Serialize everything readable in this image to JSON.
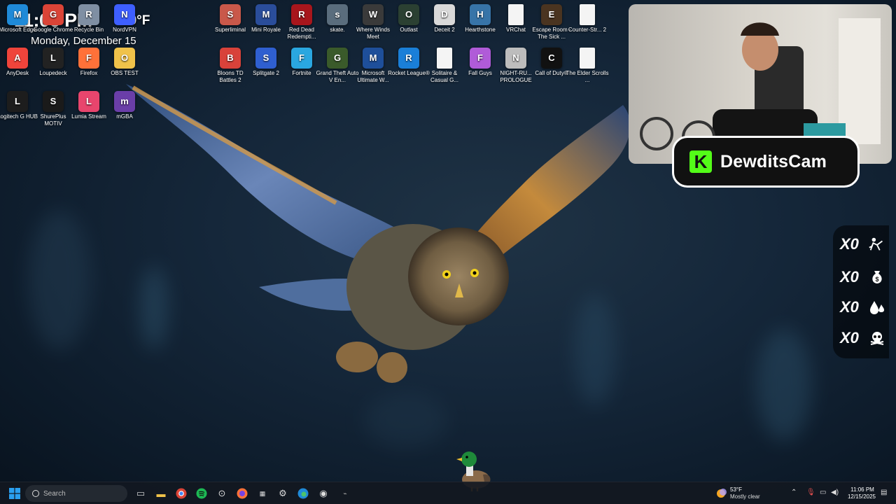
{
  "clock_widget": {
    "time": "11:06 PM",
    "temperature": "50°F",
    "date": "Monday, December 15"
  },
  "desktop_icons": [
    {
      "label": "Microsoft Edge",
      "icon": "edge-icon",
      "color": "#1f8ad8"
    },
    {
      "label": "Google Chrome",
      "icon": "chrome-icon",
      "color": "#db4437"
    },
    {
      "label": "Recycle Bin",
      "icon": "recycle-bin-icon",
      "color": "#7f8fa3"
    },
    {
      "label": "NordVPN",
      "icon": "nordvpn-icon",
      "color": "#3e5fff"
    },
    {
      "label": "AnyDesk",
      "icon": "anydesk-icon",
      "color": "#ef443b"
    },
    {
      "label": "Loupedeck",
      "icon": "loupedeck-icon",
      "color": "#222222"
    },
    {
      "label": "Firefox",
      "icon": "firefox-icon",
      "color": "#ff7139"
    },
    {
      "label": "OBS TEST",
      "icon": "folder-icon",
      "color": "#f0c24a"
    },
    {
      "label": "Logitech G HUB",
      "icon": "logitech-icon",
      "color": "#1d1d1d"
    },
    {
      "label": "ShurePlus MOTIV",
      "icon": "shure-icon",
      "color": "#1a1a1a"
    },
    {
      "label": "Lumia Stream",
      "icon": "lumia-icon",
      "color": "#e8456d"
    },
    {
      "label": "mGBA",
      "icon": "mgba-icon",
      "color": "#6a3ea8"
    },
    {
      "label": "Superliminal",
      "icon": "superliminal-icon",
      "color": "#c9584a"
    },
    {
      "label": "Mini Royale",
      "icon": "mini-royale-icon",
      "color": "#2a4d9a"
    },
    {
      "label": "Red Dead Redempti...",
      "icon": "red-dead-icon",
      "color": "#a8161c"
    },
    {
      "label": "skate.",
      "icon": "skate-icon",
      "color": "#5a6d7d"
    },
    {
      "label": "Where Winds Meet",
      "icon": "where-winds-meet-icon",
      "color": "#3a3a3a"
    },
    {
      "label": "Outlast",
      "icon": "outlast-icon",
      "color": "#2b4032"
    },
    {
      "label": "Deceit 2",
      "icon": "deceit-icon",
      "color": "#d9d9d9"
    },
    {
      "label": "Hearthstone",
      "icon": "hearthstone-icon",
      "color": "#3774a8"
    },
    {
      "label": "VRChat",
      "icon": "document-icon",
      "color": "#f4f4f4"
    },
    {
      "label": "Escape Room - The Sick ...",
      "icon": "escape-room-icon",
      "color": "#4a3420"
    },
    {
      "label": "Counter-Str... 2",
      "icon": "document-icon",
      "color": "#f4f4f4"
    },
    {
      "label": "Bloons TD Battles 2",
      "icon": "bloons-icon",
      "color": "#d8423a"
    },
    {
      "label": "Splitgate 2",
      "icon": "splitgate-icon",
      "color": "#2f5fd0"
    },
    {
      "label": "Fortnite",
      "icon": "fortnite-icon",
      "color": "#2aa7e0"
    },
    {
      "label": "Grand Theft Auto V En...",
      "icon": "gta-icon",
      "color": "#3a5a2a"
    },
    {
      "label": "Microsoft Ultimate W...",
      "icon": "microsoft-ultimate-icon",
      "color": "#1e4f9a"
    },
    {
      "label": "Rocket League®",
      "icon": "rocket-league-icon",
      "color": "#1a7fd8"
    },
    {
      "label": "Solitaire & Casual G...",
      "icon": "document-icon",
      "color": "#f4f4f4"
    },
    {
      "label": "Fall Guys",
      "icon": "fall-guys-icon",
      "color": "#b05bd8"
    },
    {
      "label": "NIGHT-RU... PROLOGUE",
      "icon": "night-run-icon",
      "color": "#bdbdbd"
    },
    {
      "label": "Call of Duty®",
      "icon": "call-of-duty-icon",
      "color": "#111111"
    },
    {
      "label": "The Elder Scrolls ...",
      "icon": "document-icon",
      "color": "#f4f4f4"
    }
  ],
  "webcam": {
    "badge_name": "DewditsCam",
    "accent": "#53fc18"
  },
  "stats": [
    {
      "count": "X0",
      "icon": "kill-icon"
    },
    {
      "count": "X0",
      "icon": "money-bag-icon"
    },
    {
      "count": "X0",
      "icon": "blood-drop-icon"
    },
    {
      "count": "X0",
      "icon": "skull-icon"
    }
  ],
  "taskbar": {
    "search_placeholder": "Search",
    "weather_temp": "53°F",
    "weather_desc": "Mostly clear",
    "time": "11:06 PM",
    "date": "12/15/2025"
  }
}
